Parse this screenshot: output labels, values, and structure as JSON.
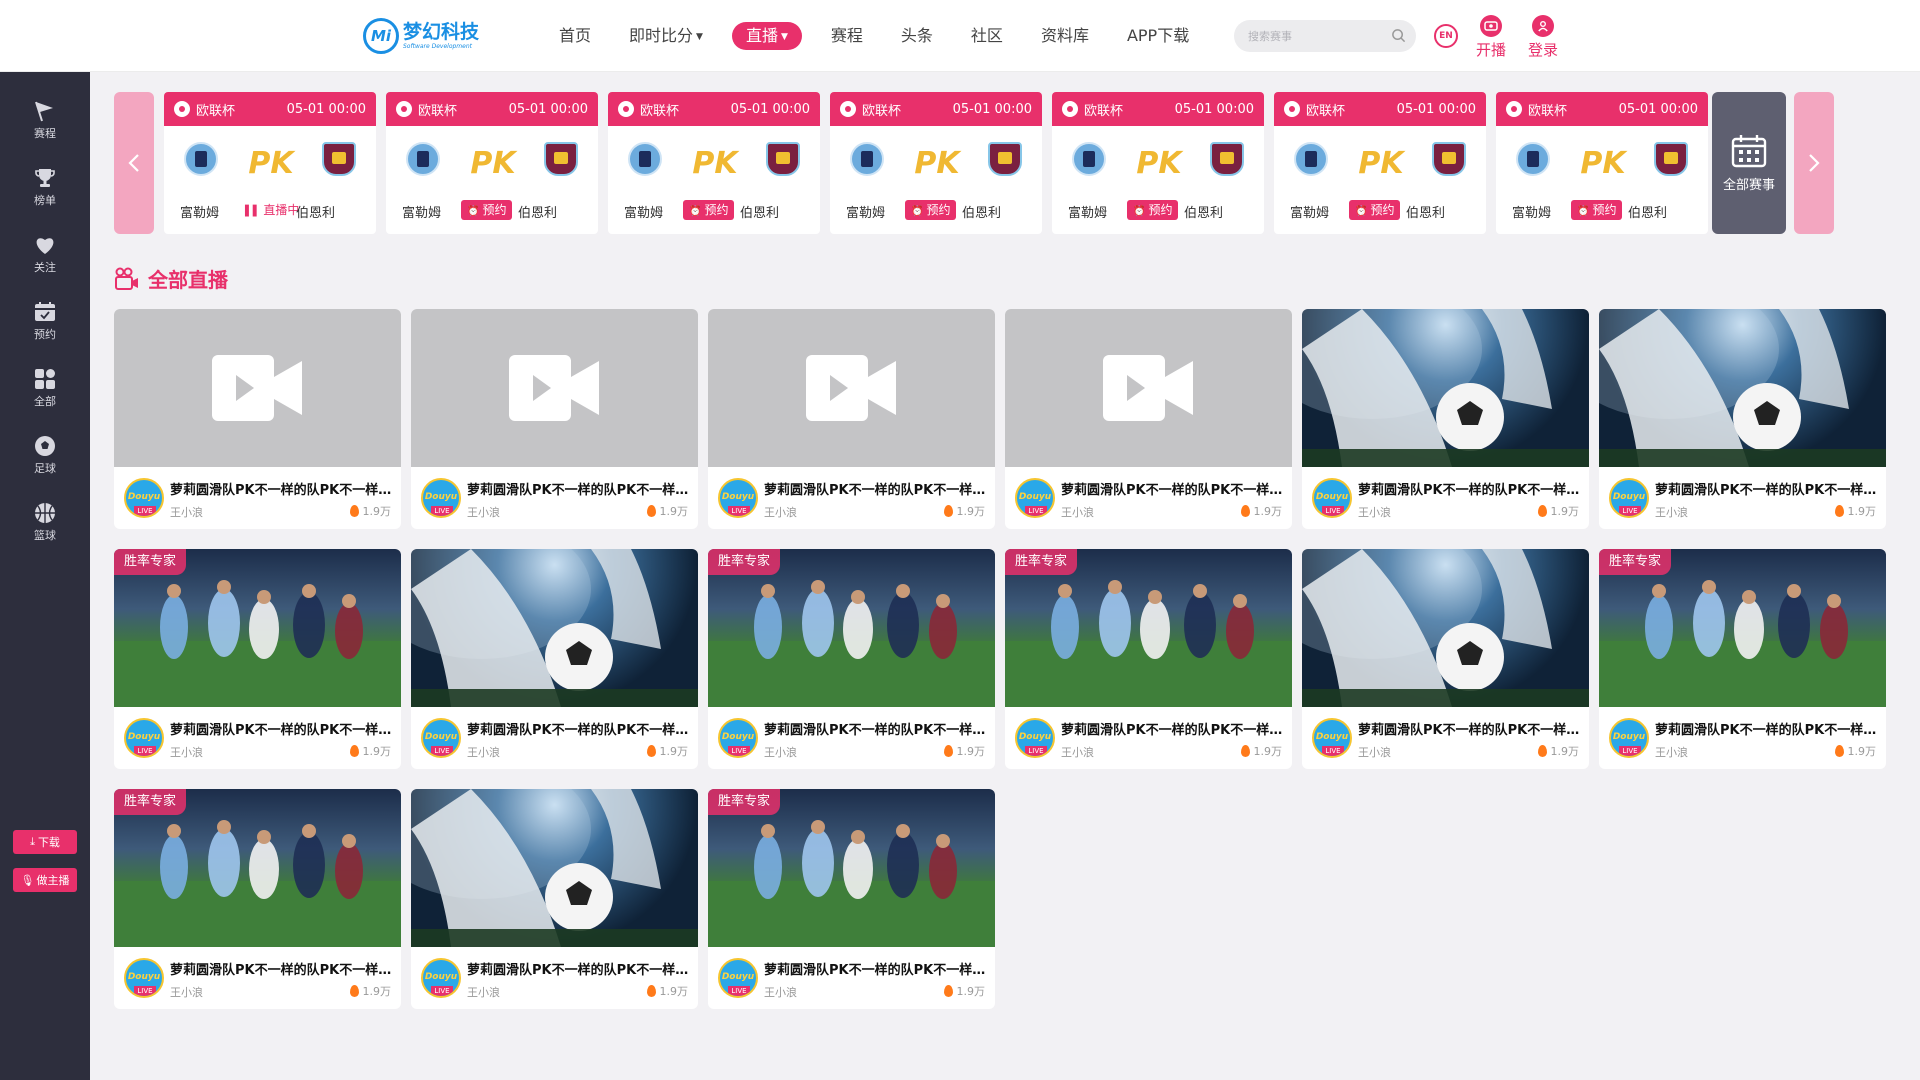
{
  "brand": {
    "logo_mark": "Mi",
    "name_cn": "梦幻科技",
    "name_en": "Software Development"
  },
  "nav": [
    {
      "label": "首页",
      "active": false,
      "caret": false
    },
    {
      "label": "即时比分",
      "active": false,
      "caret": true
    },
    {
      "label": "直播",
      "active": true,
      "caret": true
    },
    {
      "label": "赛程",
      "active": false,
      "caret": false
    },
    {
      "label": "头条",
      "active": false,
      "caret": false
    },
    {
      "label": "社区",
      "active": false,
      "caret": false
    },
    {
      "label": "资料库",
      "active": false,
      "caret": false
    },
    {
      "label": "APP下载",
      "active": false,
      "caret": false
    }
  ],
  "search": {
    "placeholder": "搜索赛事"
  },
  "header_actions": {
    "lang": "EN",
    "broadcast": "开播",
    "login": "登录"
  },
  "sidebar": {
    "items": [
      {
        "label": "赛程",
        "icon": "flag-icon"
      },
      {
        "label": "榜单",
        "icon": "trophy-icon"
      },
      {
        "label": "关注",
        "icon": "heart-icon"
      },
      {
        "label": "预约",
        "icon": "calendar-icon"
      },
      {
        "label": "全部",
        "icon": "grid-icon"
      },
      {
        "label": "足球",
        "icon": "football-icon"
      },
      {
        "label": "篮球",
        "icon": "basketball-icon"
      }
    ],
    "download": "下载",
    "be_host": "做主播"
  },
  "matches": [
    {
      "league": "欧联杯",
      "time": "05-01 00:00",
      "home": "富勒姆",
      "away": "伯恩利",
      "vs": "PK",
      "status": "直播中",
      "status_type": "live"
    },
    {
      "league": "欧联杯",
      "time": "05-01 00:00",
      "home": "富勒姆",
      "away": "伯恩利",
      "vs": "PK",
      "status": "预约",
      "status_type": "reserve"
    },
    {
      "league": "欧联杯",
      "time": "05-01 00:00",
      "home": "富勒姆",
      "away": "伯恩利",
      "vs": "PK",
      "status": "预约",
      "status_type": "reserve"
    },
    {
      "league": "欧联杯",
      "time": "05-01 00:00",
      "home": "富勒姆",
      "away": "伯恩利",
      "vs": "PK",
      "status": "预约",
      "status_type": "reserve"
    },
    {
      "league": "欧联杯",
      "time": "05-01 00:00",
      "home": "富勒姆",
      "away": "伯恩利",
      "vs": "PK",
      "status": "预约",
      "status_type": "reserve"
    },
    {
      "league": "欧联杯",
      "time": "05-01 00:00",
      "home": "富勒姆",
      "away": "伯恩利",
      "vs": "PK",
      "status": "预约",
      "status_type": "reserve"
    },
    {
      "league": "欧联杯",
      "time": "05-01 00:00",
      "home": "富勒姆",
      "away": "伯恩利",
      "vs": "PK",
      "status": "预约",
      "status_type": "reserve"
    }
  ],
  "all_matches_label": "全部赛事",
  "section_title": "全部直播",
  "live_cards": [
    {
      "thumb": "placeholder",
      "badge": "",
      "title": "萝莉圆滑队PK不一样的队PK不一样的队",
      "anchor": "王小浪",
      "heat": "1.9万"
    },
    {
      "thumb": "placeholder",
      "badge": "",
      "title": "萝莉圆滑队PK不一样的队PK不一样的队",
      "anchor": "王小浪",
      "heat": "1.9万"
    },
    {
      "thumb": "placeholder",
      "badge": "",
      "title": "萝莉圆滑队PK不一样的队PK不一样的队",
      "anchor": "王小浪",
      "heat": "1.9万"
    },
    {
      "thumb": "placeholder",
      "badge": "",
      "title": "萝莉圆滑队PK不一样的队PK不一样的队",
      "anchor": "王小浪",
      "heat": "1.9万"
    },
    {
      "thumb": "ball",
      "badge": "",
      "title": "萝莉圆滑队PK不一样的队PK不一样的队",
      "anchor": "王小浪",
      "heat": "1.9万"
    },
    {
      "thumb": "ball",
      "badge": "",
      "title": "萝莉圆滑队PK不一样的队PK不一样的队",
      "anchor": "王小浪",
      "heat": "1.9万"
    },
    {
      "thumb": "players",
      "badge": "胜率专家",
      "title": "萝莉圆滑队PK不一样的队PK不一样的队",
      "anchor": "王小浪",
      "heat": "1.9万"
    },
    {
      "thumb": "ball",
      "badge": "",
      "title": "萝莉圆滑队PK不一样的队PK不一样的队",
      "anchor": "王小浪",
      "heat": "1.9万"
    },
    {
      "thumb": "players",
      "badge": "胜率专家",
      "title": "萝莉圆滑队PK不一样的队PK不一样的队",
      "anchor": "王小浪",
      "heat": "1.9万"
    },
    {
      "thumb": "players",
      "badge": "胜率专家",
      "title": "萝莉圆滑队PK不一样的队PK不一样的队",
      "anchor": "王小浪",
      "heat": "1.9万"
    },
    {
      "thumb": "ball",
      "badge": "",
      "title": "萝莉圆滑队PK不一样的队PK不一样的队",
      "anchor": "王小浪",
      "heat": "1.9万"
    },
    {
      "thumb": "players",
      "badge": "胜率专家",
      "title": "萝莉圆滑队PK不一样的队PK不一样的队",
      "anchor": "王小浪",
      "heat": "1.9万"
    },
    {
      "thumb": "players",
      "badge": "胜率专家",
      "title": "萝莉圆滑队PK不一样的队PK不一样的队",
      "anchor": "王小浪",
      "heat": "1.9万"
    },
    {
      "thumb": "ball",
      "badge": "",
      "title": "萝莉圆滑队PK不一样的队PK不一样的队",
      "anchor": "王小浪",
      "heat": "1.9万"
    },
    {
      "thumb": "players",
      "badge": "胜率专家",
      "title": "萝莉圆滑队PK不一样的队PK不一样的队",
      "anchor": "王小浪",
      "heat": "1.9万"
    }
  ],
  "colors": {
    "accent": "#e8306b",
    "sidebar_bg": "#2d2e3d",
    "page_bg": "#f2f1f4",
    "brand_blue": "#1a8fe3"
  }
}
